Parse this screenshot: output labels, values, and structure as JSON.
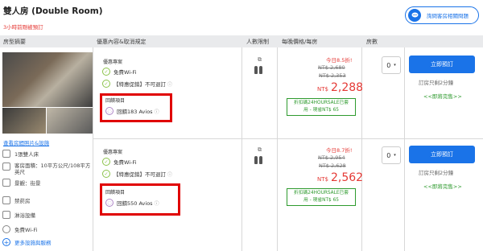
{
  "room": {
    "title": "雙人房 (Double Room)",
    "booked_notice": "3小時前剛被預訂"
  },
  "ask_button": {
    "label": "詢問客房相關問題"
  },
  "table_headers": {
    "summary": "房型摘要",
    "perks": "優惠內容&取消規定",
    "people": "人數限制",
    "price": "每晚價格/每房",
    "rooms": "房數"
  },
  "summary": {
    "view_photos": "查看房間照片&設施",
    "facilities": [
      {
        "icon": "bed-icon",
        "text": "1張雙人床"
      },
      {
        "icon": "area-icon",
        "text": "客房面積：10平方公尺/108平方英尺"
      },
      {
        "icon": "view-icon",
        "text": "景觀：街景"
      },
      {
        "icon": "no-smoking-icon",
        "text": "禁菸房"
      },
      {
        "icon": "shower-icon",
        "text": "淋浴設備"
      },
      {
        "icon": "wifi-icon",
        "text": "免費Wi-Fi"
      }
    ],
    "more_facilities": "更多設施與服務"
  },
  "offers": [
    {
      "perks_title": "優惠專案",
      "wifi": "免費Wi-Fi",
      "cancel_policy": "【特惠促銷】不可退訂",
      "reward_title": "回饋項目",
      "reward": "回饋183 Avios",
      "discount_badge": "今日8.5折!",
      "original_price_1": "NT$ 2,680",
      "original_price_2": "NT$ 2,353",
      "price_currency": "NT$",
      "price": "2,288",
      "coupon_line1": "折扣碼24HOURSALE已套",
      "coupon_line2": "用 - 現省NT$ 65",
      "rooms_value": "0",
      "book_label": "立即預訂",
      "remaining": "訂房只剩2分鐘",
      "sold_out_soon": "<<即將完售>>"
    },
    {
      "perks_title": "優惠專案",
      "wifi": "免費Wi-Fi",
      "cancel_policy": "【特惠促銷】不可退訂",
      "reward_title": "回饋項目",
      "reward": "回饋550 Avios",
      "discount_badge": "今日8.7折!",
      "original_price_1": "NT$ 2,954",
      "original_price_2": "NT$ 2,628",
      "price_currency": "NT$",
      "price": "2,562",
      "coupon_line1": "折扣碼24HOURSALE已套",
      "coupon_line2": "用 - 現省NT$ 65",
      "rooms_value": "0",
      "book_label": "立即預訂",
      "remaining": "訂房只剩2分鐘",
      "sold_out_soon": "<<即將完售>>"
    }
  ]
}
